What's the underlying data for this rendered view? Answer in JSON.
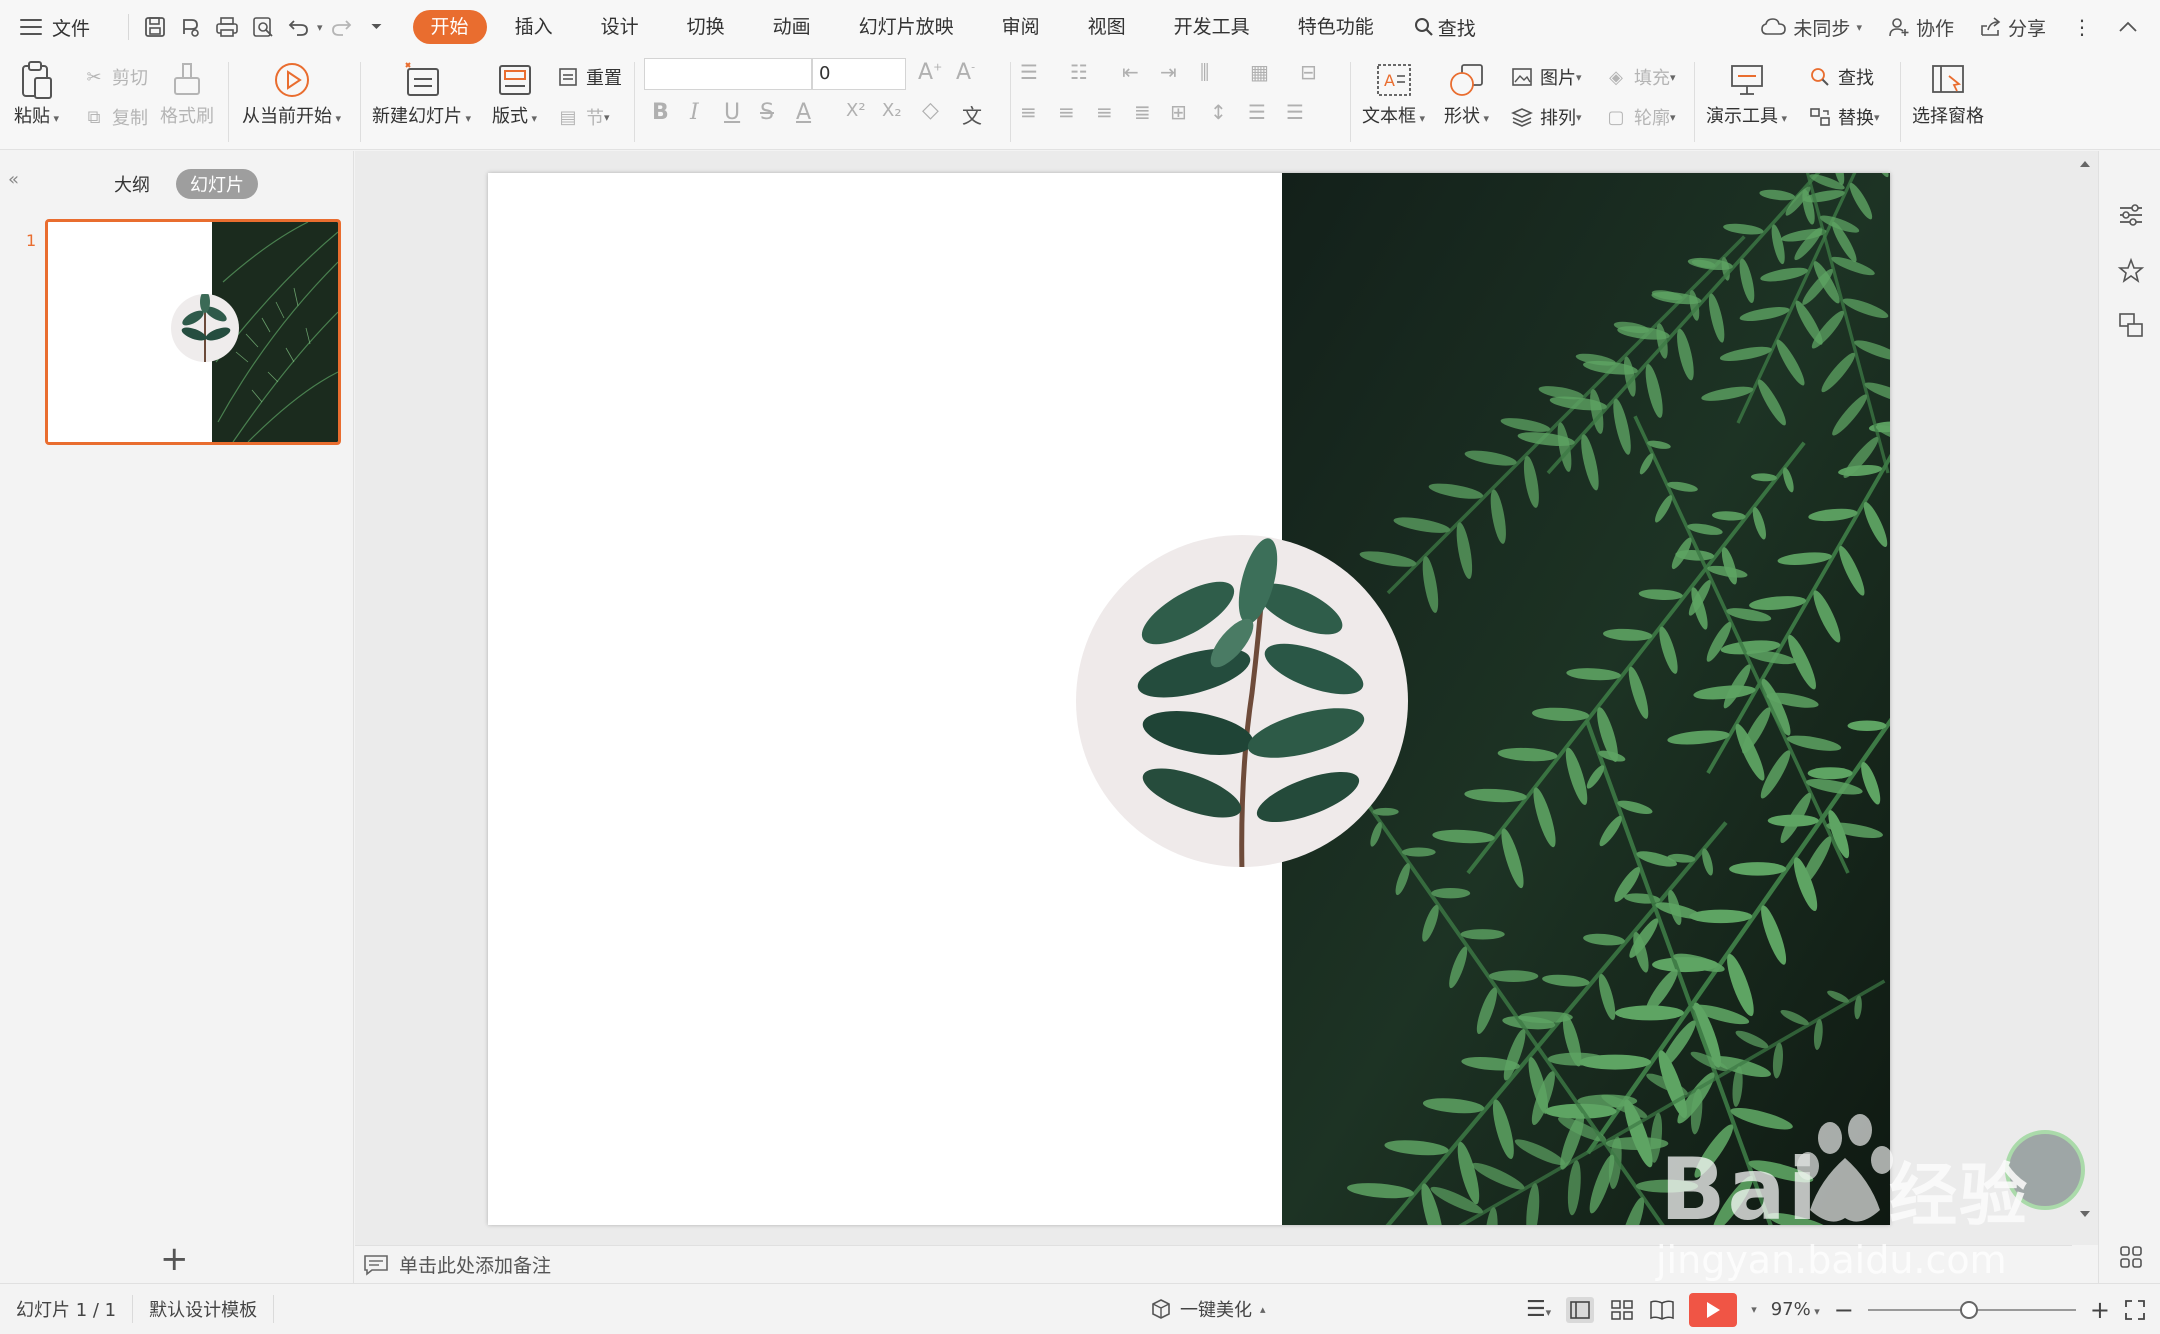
{
  "menubar": {
    "file": "文件",
    "tabs": [
      "开始",
      "插入",
      "设计",
      "切换",
      "动画",
      "幻灯片放映",
      "审阅",
      "视图",
      "开发工具",
      "特色功能"
    ],
    "active_tab": "开始",
    "search": "查找",
    "right": {
      "sync": "未同步",
      "collab": "协作",
      "share": "分享"
    }
  },
  "ribbon": {
    "paste": "粘贴",
    "cut": "剪切",
    "copy": "复制",
    "format_painter": "格式刷",
    "play_from_current": "从当前开始",
    "new_slide": "新建幻灯片",
    "layout": "版式",
    "reset": "重置",
    "section": "节",
    "font_size": "0",
    "text_box": "文本框",
    "shape": "形状",
    "picture": "图片",
    "fill": "填充",
    "arrange": "排列",
    "outline": "轮廓",
    "present_tools": "演示工具",
    "find": "查找",
    "replace": "替换",
    "selection_pane": "选择窗格"
  },
  "left_panel": {
    "tab_outline": "大纲",
    "tab_slides": "幻灯片",
    "slide_number": "1"
  },
  "notes": {
    "placeholder": "单击此处添加备注"
  },
  "statusbar": {
    "slide_info": "幻灯片 1 / 1",
    "template": "默认设计模板",
    "beautify": "一键美化",
    "zoom": "97%"
  },
  "watermark": {
    "brand": "Bai",
    "brand_cn": "经验",
    "url": "jingyan.baidu.com"
  },
  "colors": {
    "accent": "#e96d2f",
    "play": "#f05545",
    "fern_dark": "#1b2b1e"
  }
}
